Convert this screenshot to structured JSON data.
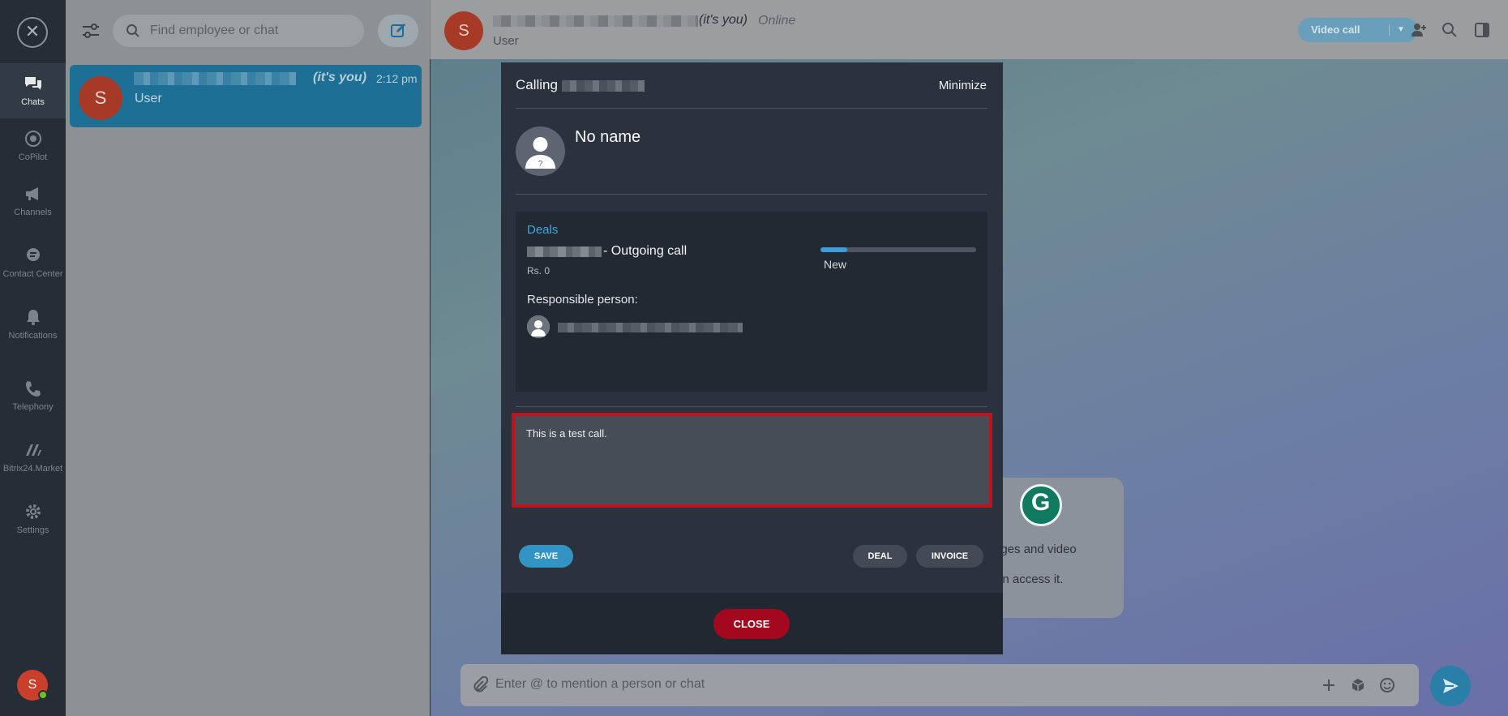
{
  "sidebar": {
    "close_icon": "close-icon",
    "items": [
      {
        "label": "Chats",
        "icon": "chat-bubbles-icon",
        "active": true
      },
      {
        "label": "CoPilot",
        "icon": "copilot-icon"
      },
      {
        "label": "Channels",
        "icon": "megaphone-icon"
      },
      {
        "label": "Contact Center",
        "icon": "contact-center-icon"
      },
      {
        "label": "Notifications",
        "icon": "bell-icon"
      },
      {
        "label": "Telephony",
        "icon": "phone-icon"
      },
      {
        "label": "Bitrix24.Market",
        "icon": "market-icon"
      },
      {
        "label": "Settings",
        "icon": "gear-icon"
      }
    ],
    "user_initial": "S"
  },
  "chat_list": {
    "search_placeholder": "Find employee or chat",
    "items": [
      {
        "initial": "S",
        "you_tag": "(it's you)",
        "time": "2:12 pm",
        "role": "User"
      }
    ]
  },
  "chat_header": {
    "initial": "S",
    "you_tag": "(it's you)",
    "status": "Online",
    "role": "User",
    "video_call_label": "Video call"
  },
  "welcome": {
    "line1": "ages and video",
    "line2": "an access it."
  },
  "input": {
    "placeholder": "Enter @ to mention a person or chat"
  },
  "call_dialog": {
    "title": "Calling",
    "minimize_label": "Minimize",
    "contact_name": "No name",
    "crm": {
      "section_title": "Deals",
      "deal_title": "- Outgoing call",
      "deal_amount": "Rs. 0",
      "stage": "New",
      "stage_progress": 0.17,
      "responsible_label": "Responsible person:"
    },
    "notes_value": "This is a test call.",
    "save_label": "SAVE",
    "deal_label": "DEAL",
    "invoice_label": "INVOICE",
    "close_label": "CLOSE"
  },
  "colors": {
    "accent": "#3ea6dd",
    "close_button": "#a3081f",
    "highlight_border": "#c0121c",
    "avatar": "#c8402b"
  }
}
